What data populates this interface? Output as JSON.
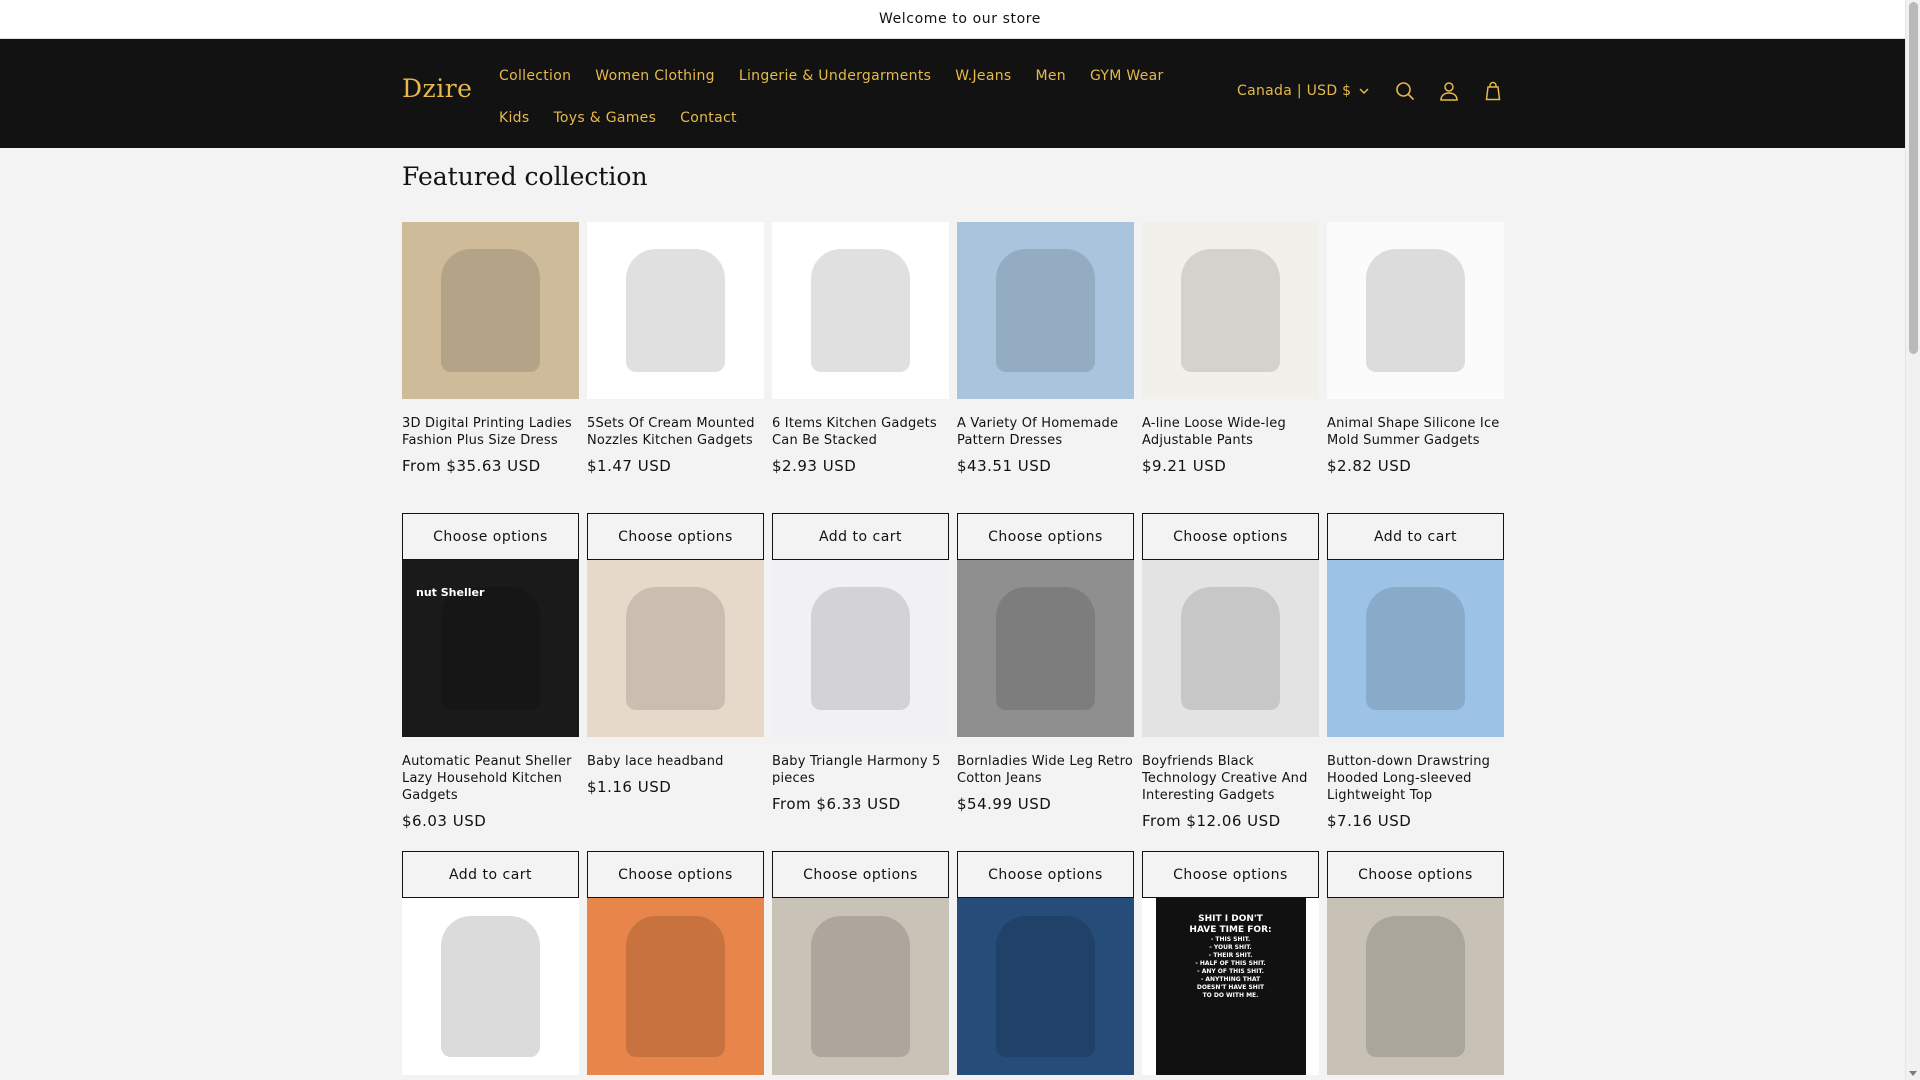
{
  "announcement": "Welcome to our store",
  "header": {
    "logo": "Dzire",
    "nav": [
      "Collection",
      "Women Clothing",
      "Lingerie & Undergarments",
      "W.Jeans",
      "Men",
      "GYM Wear",
      "Kids",
      "Toys & Games",
      "Contact"
    ],
    "country": "Canada | USD $",
    "icons": [
      "search-icon",
      "account-icon",
      "cart-icon"
    ]
  },
  "section": {
    "title": "Featured collection"
  },
  "products": [
    {
      "title": "3D Digital Printing Ladies Fashion Plus Size Dress",
      "price": "From $35.63 USD",
      "button": "Choose options",
      "bg": "#cdbb9a"
    },
    {
      "title": "5Sets Of Cream Mounted Nozzles Kitchen Gadgets",
      "price": "$1.47 USD",
      "button": "Choose options",
      "bg": "#ffffff"
    },
    {
      "title": "6 Items Kitchen Gadgets Can Be Stacked",
      "price": "$2.93 USD",
      "button": "Add to cart",
      "bg": "#ffffff"
    },
    {
      "title": "A Variety Of Homemade Pattern Dresses",
      "price": "$43.51 USD",
      "button": "Choose options",
      "bg": "#a9c4dc"
    },
    {
      "title": "A-line Loose Wide-leg Adjustable Pants",
      "price": "$9.21 USD",
      "button": "Choose options",
      "bg": "#f2f0ea"
    },
    {
      "title": "Animal Shape Silicone Ice Mold Summer Gadgets",
      "price": "$2.82 USD",
      "button": "Add to cart",
      "bg": "#fbfbfb"
    },
    {
      "title": "Automatic Peanut Sheller Lazy Household Kitchen Gadgets",
      "price": "$6.03 USD",
      "button": "Add to cart",
      "bg": "#1a1a1a",
      "label": "nut Sheller"
    },
    {
      "title": "Baby lace headband",
      "price": "$1.16 USD",
      "button": "Choose options",
      "bg": "#e7d9c9"
    },
    {
      "title": "Baby Triangle Harmony 5 pieces",
      "price": "From $6.33 USD",
      "button": "Choose options",
      "bg": "#f1f1f3"
    },
    {
      "title": "Bornladies Wide Leg Retro Cotton Jeans",
      "price": "$54.99 USD",
      "button": "Choose options",
      "bg": "#8f8f8f"
    },
    {
      "title": "Boyfriends Black Technology Creative And Interesting Gadgets",
      "price": "From $12.06 USD",
      "button": "Choose options",
      "bg": "#e3e3e3"
    },
    {
      "title": "Button-down Drawstring Hooded Long-sleeved Lightweight Top",
      "price": "$7.16 USD",
      "button": "Choose options",
      "bg": "#9cc3e6"
    }
  ],
  "partial_products": [
    {
      "bg": "#ffffff"
    },
    {
      "bg": "#e8854a"
    },
    {
      "bg": "#c9c2b6"
    },
    {
      "bg": "#264d7a"
    },
    {
      "bg": "#ffffff",
      "text_lines": [
        "SHIT I DON'T",
        "HAVE TIME FOR:",
        "- THIS SHIT.",
        "- YOUR SHIT.",
        "- THEIR SHIT.",
        "- HALF OF THIS SHIT.",
        "- ANY OF THIS SHIT.",
        "- ANYTHING THAT",
        "DOESN'T HAVE SHIT",
        "TO DO WITH ME."
      ]
    },
    {
      "bg": "#c8c2b6"
    }
  ],
  "colors": {
    "header_bg": "#121212",
    "accent": "#e6b94a",
    "page_bg": "#f3f3f3"
  }
}
